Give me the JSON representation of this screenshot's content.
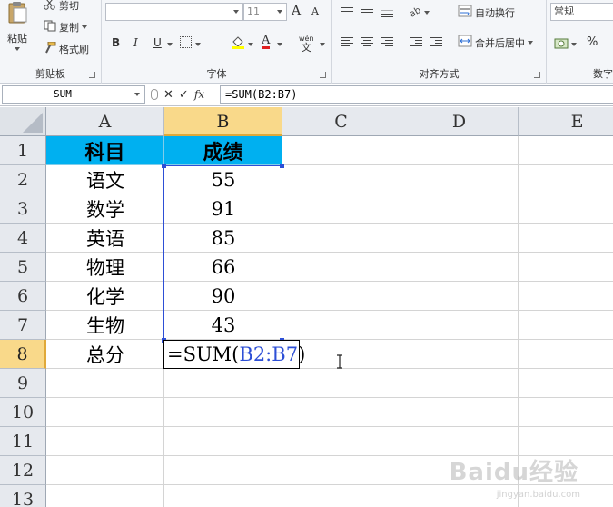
{
  "ribbon": {
    "clipboard": {
      "label": "剪贴板",
      "paste": "粘贴",
      "cut": "剪切",
      "copy": "复制",
      "format_painter": "格式刷"
    },
    "font": {
      "label": "字体",
      "font_name": "",
      "font_size": "11",
      "bold": "B",
      "italic": "I",
      "underline": "U",
      "grow": "A",
      "shrink": "A",
      "font_color": "A",
      "phonetic": "wén",
      "phonetic_char": "文"
    },
    "alignment": {
      "label": "对齐方式",
      "wrap_text": "自动换行",
      "merge_center": "合并后居中"
    },
    "number": {
      "label": "数字",
      "format": "常规",
      "percent": "%"
    }
  },
  "formula_bar": {
    "name_box": "SUM",
    "cancel": "✕",
    "enter": "✓",
    "fx": "fx",
    "formula": "=SUM(B2:B7)"
  },
  "sheet": {
    "columns": [
      "A",
      "B",
      "C",
      "D",
      "E"
    ],
    "rows": [
      "1",
      "2",
      "3",
      "4",
      "5",
      "6",
      "7",
      "8",
      "9",
      "10",
      "11",
      "12",
      "13"
    ],
    "header": {
      "a": "科目",
      "b": "成绩"
    },
    "data": [
      {
        "subject": "语文",
        "score": "55"
      },
      {
        "subject": "数学",
        "score": "91"
      },
      {
        "subject": "英语",
        "score": "85"
      },
      {
        "subject": "物理",
        "score": "66"
      },
      {
        "subject": "化学",
        "score": "90"
      },
      {
        "subject": "生物",
        "score": "43"
      }
    ],
    "total_label": "总分",
    "editing": {
      "prefix": "=SUM(",
      "ref": "B2:B7",
      "suffix": ")"
    },
    "header_fill": "#00b0f0",
    "range_color": "#2d4fd6"
  },
  "watermark": {
    "text": "Baidu经验",
    "sub": "jingyan.baidu.com"
  }
}
